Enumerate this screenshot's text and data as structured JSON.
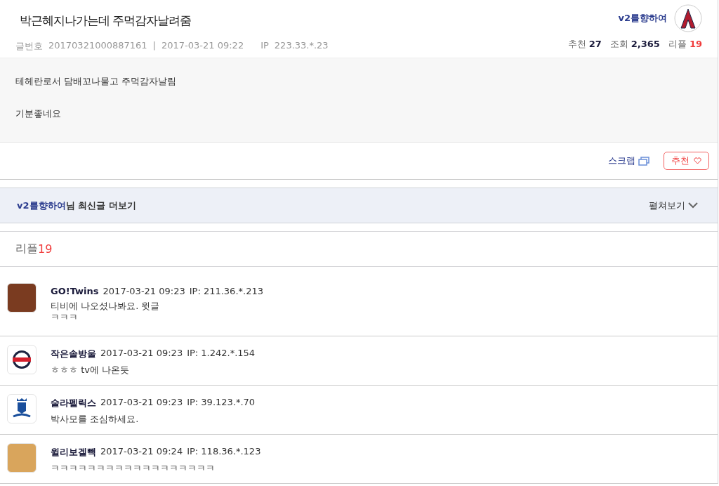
{
  "post": {
    "title": "박근혜지나가는데 주먹감자날려줌",
    "number_label": "글번호",
    "number": "20170321000887161",
    "separator": "|",
    "datetime": "2017-03-21 09:22",
    "ip_label": "IP",
    "ip": "223.33.*.23",
    "author": "v2를향하여",
    "stats": [
      {
        "label": "추천",
        "value": "27",
        "kind": "normal"
      },
      {
        "label": "조회",
        "value": "2,365",
        "kind": "normal"
      },
      {
        "label": "리플",
        "value": "19",
        "kind": "accent"
      }
    ],
    "body": [
      "테헤란로서 담배꼬나물고 주먹감자날림",
      "기분좋네요"
    ],
    "scrap": "스크랩",
    "recommend": "추천"
  },
  "more_bar": {
    "author": "v2를향하여",
    "suffix": "님 최신글 더보기",
    "toggle": "펼쳐보기"
  },
  "replies": {
    "label": "리플",
    "count": "19"
  },
  "comments": [
    {
      "author": "GO!Twins",
      "datetime": "2017-03-21 09:23",
      "ip": "IP: 211.36.*.213",
      "kind": "photo",
      "lines": [
        "티비에 나오셨나봐요. 윗글",
        "ㅋㅋㅋ"
      ]
    },
    {
      "author": "작은솔방울",
      "datetime": "2017-03-21 09:23",
      "ip": "IP: 1.242.*.154",
      "kind": "bears",
      "lines": [
        "ㅎㅎㅎ tv에 나온듯"
      ]
    },
    {
      "author": "술라펠릭스",
      "datetime": "2017-03-21 09:23",
      "ip": "IP: 39.123.*.70",
      "kind": "royals",
      "lines": [
        "박사모를 조심하세요."
      ]
    },
    {
      "author": "윌리보겔빽",
      "datetime": "2017-03-21 09:24",
      "ip": "IP: 118.36.*.123",
      "kind": "dog",
      "lines": [
        "ㅋㅋㅋㅋㅋㅋㅋㅋㅋㅋㅋㅋㅋㅋㅋㅋㅋㅋ"
      ]
    }
  ]
}
